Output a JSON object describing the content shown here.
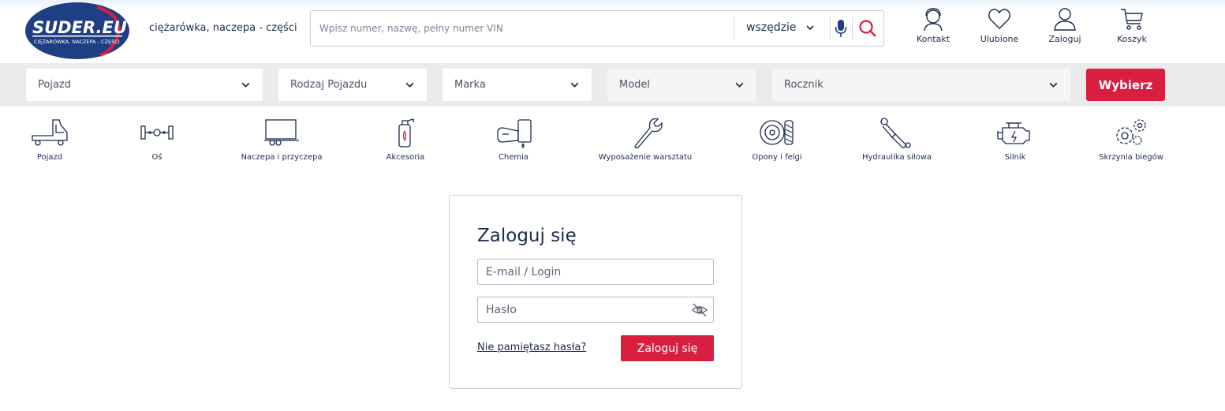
{
  "header": {
    "logo": {
      "text": "SUDER.EU",
      "subtext": "CIĘŻARÓWKA, NACZEPA - CZĘŚCI",
      "bg_color": "#1f3f84",
      "accent_color": "#d91f3f"
    },
    "tagline": "ciężarówka, naczepa - części",
    "search": {
      "placeholder": "Wpisz numer, nazwę, pełny numer VIN",
      "value": "",
      "scope_selected": "wszędzie"
    },
    "actions": [
      {
        "label": "Kontakt",
        "icon": "person-headset-icon"
      },
      {
        "label": "Ulubione",
        "icon": "heart-icon"
      },
      {
        "label": "Zaloguj",
        "icon": "user-icon"
      },
      {
        "label": "Koszyk",
        "icon": "cart-icon"
      }
    ]
  },
  "vehicle_filter": {
    "selects": [
      {
        "label": "Pojazd",
        "disabled": false
      },
      {
        "label": "Rodzaj Pojazdu",
        "disabled": false
      },
      {
        "label": "Marka",
        "disabled": false
      },
      {
        "label": "Model",
        "disabled": true
      },
      {
        "label": "Rocznik",
        "disabled": true
      }
    ],
    "button_label": "Wybierz"
  },
  "categories": [
    {
      "label": "Pojazd",
      "icon": "truck-icon"
    },
    {
      "label": "Oś",
      "icon": "axle-icon"
    },
    {
      "label": "Naczepa i przyczepa",
      "icon": "trailer-icon"
    },
    {
      "label": "Akcesoria",
      "icon": "fire-extinguisher-icon"
    },
    {
      "label": "Chemia",
      "icon": "oil-can-icon"
    },
    {
      "label": "Wyposażenie warsztatu",
      "icon": "wrench-icon"
    },
    {
      "label": "Opony i felgi",
      "icon": "tire-icon"
    },
    {
      "label": "Hydraulika siłowa",
      "icon": "hydraulic-cylinder-icon"
    },
    {
      "label": "Silnik",
      "icon": "engine-icon"
    },
    {
      "label": "Skrzynia biegów",
      "icon": "gears-icon"
    }
  ],
  "login": {
    "title": "Zaloguj się",
    "email_placeholder": "E-mail / Login",
    "password_placeholder": "Hasło",
    "forgot_link": "Nie pamiętasz hasła?",
    "submit_label": "Zaloguj się"
  },
  "colors": {
    "primary_red": "#d91f3f",
    "text_dark": "#1d2b4f",
    "filter_bar_bg": "#ebebeb"
  }
}
